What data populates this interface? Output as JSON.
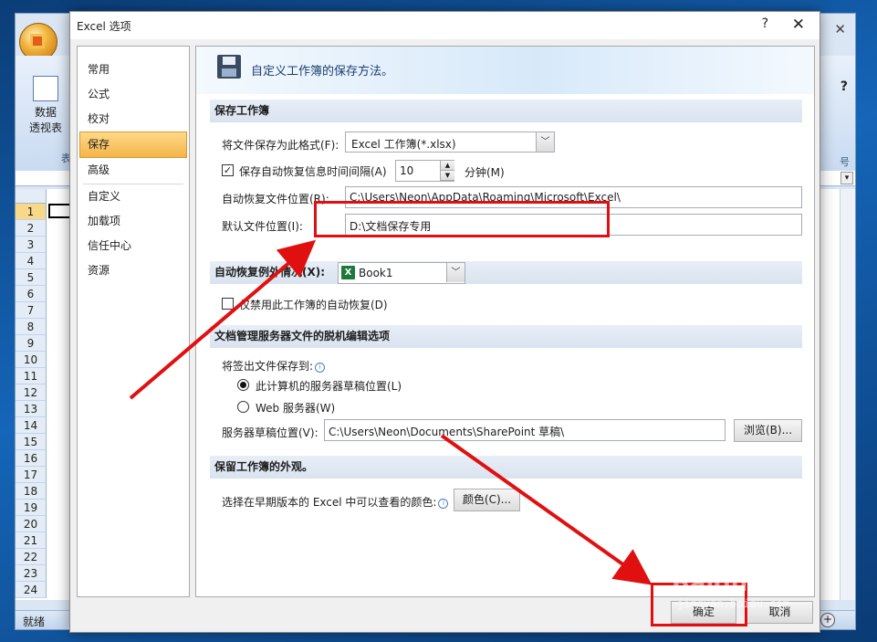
{
  "background_app": {
    "ribbon_button_line1": "数据",
    "ribbon_button_line2": "透视表",
    "ribbon_group_fragment": "表",
    "ribbon_right_fragment": "号",
    "row_numbers": [
      "1",
      "2",
      "3",
      "4",
      "5",
      "6",
      "7",
      "8",
      "9",
      "10",
      "11",
      "12",
      "13",
      "14",
      "15",
      "16",
      "17",
      "18",
      "19",
      "20",
      "21",
      "22",
      "23",
      "24"
    ],
    "status_text": "就绪",
    "close_glyph": "✕"
  },
  "dialog": {
    "title": "Excel 选项",
    "help": "?",
    "close": "✕",
    "nav_items": [
      {
        "label": "常用"
      },
      {
        "label": "公式"
      },
      {
        "label": "校对"
      },
      {
        "label": "保存"
      },
      {
        "label": "高级"
      },
      {
        "label": "自定义"
      },
      {
        "label": "加载项"
      },
      {
        "label": "信任中心"
      },
      {
        "label": "资源"
      }
    ],
    "selected_nav": "保存",
    "header_text": "自定义工作簿的保存方法。",
    "sections": {
      "save_workbook": {
        "title": "保存工作簿",
        "format_label": "将文件保存为此格式(F):",
        "format_value": "Excel 工作簿(*.xlsx)",
        "autorecover_checkbox_label": "保存自动恢复信息时间间隔(A)",
        "autorecover_checked": true,
        "autorecover_minutes": "10",
        "minutes_label": "分钟(M)",
        "autorecover_location_label": "自动恢复文件位置(R):",
        "autorecover_location_value": "C:\\Users\\Neon\\AppData\\Roaming\\Microsoft\\Excel\\",
        "default_location_label": "默认文件位置(I):",
        "default_location_value": "D:\\文档保存专用"
      },
      "autorecover_exceptions": {
        "title": "自动恢复例外情况(X):",
        "workbook_value": "Book1",
        "disable_checkbox_label": "仅禁用此工作簿的自动恢复(D)",
        "disable_checked": false
      },
      "offline_editing": {
        "title": "文档管理服务器文件的脱机编辑选项",
        "save_checked_out_label": "将签出文件保存到:",
        "radio_local": "此计算机的服务器草稿位置(L)",
        "radio_web": "Web 服务器(W)",
        "selected_radio": "local",
        "drafts_location_label": "服务器草稿位置(V):",
        "drafts_location_value": "C:\\Users\\Neon\\Documents\\SharePoint 草稿\\",
        "browse_button": "浏览(B)..."
      },
      "preserve_appearance": {
        "title": "保留工作簿的外观。",
        "colors_label": "选择在早期版本的 Excel 中可以查看的颜色:",
        "colors_button": "颜色(C)..."
      }
    },
    "ok_button": "确定",
    "cancel_button": "取消"
  },
  "annotation_color": "#e01010",
  "watermark": {
    "text": "Baidu经验",
    "subtext": "jingyan.baidu.com"
  }
}
